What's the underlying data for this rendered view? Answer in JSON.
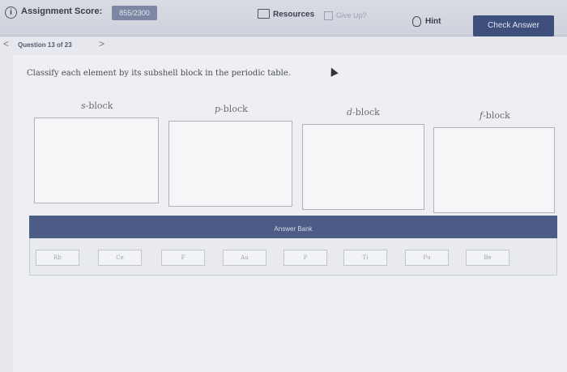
{
  "header": {
    "score_label": "Assignment Score:",
    "score_value": "855/2300",
    "resources_label": "Resources",
    "give_up_label": "Give Up?",
    "hint_label": "Hint",
    "check_answer_label": "Check Answer"
  },
  "question_nav": {
    "prev_symbol": "<",
    "position_text": "Question 13 of 23",
    "next_symbol": ">"
  },
  "prompt": "Classify each element by its subshell block in the periodic table.",
  "blocks": [
    {
      "letter": "s",
      "suffix": "-block"
    },
    {
      "letter": "p",
      "suffix": "-block"
    },
    {
      "letter": "d",
      "suffix": "-block"
    },
    {
      "letter": "f",
      "suffix": "-block"
    }
  ],
  "answer_bank": {
    "title": "Answer Bank",
    "items": [
      "Rb",
      "Ce",
      "F",
      "Au",
      "P",
      "Ti",
      "Pu",
      "Be"
    ]
  }
}
